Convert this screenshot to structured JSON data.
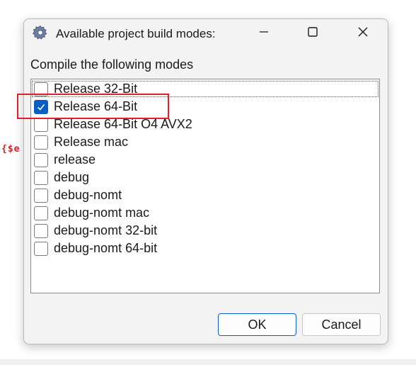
{
  "background": {
    "snippet_text": "{$e"
  },
  "dialog": {
    "title": "Available project build modes:",
    "icons": {
      "app": "gear-icon",
      "minimize": "minimize-icon",
      "maximize": "maximize-icon",
      "close": "close-icon"
    },
    "heading": "Compile the following modes",
    "modes": [
      {
        "label": "Release 32-Bit",
        "checked": false
      },
      {
        "label": "Release 64-Bit",
        "checked": true
      },
      {
        "label": "Release 64-Bit O4 AVX2",
        "checked": false
      },
      {
        "label": "Release mac",
        "checked": false
      },
      {
        "label": "release",
        "checked": false
      },
      {
        "label": "debug",
        "checked": false
      },
      {
        "label": "debug-nomt",
        "checked": false
      },
      {
        "label": "debug-nomt mac",
        "checked": false
      },
      {
        "label": "debug-nomt 32-bit",
        "checked": false
      },
      {
        "label": "debug-nomt 64-bit",
        "checked": false
      }
    ],
    "ok_label": "OK",
    "cancel_label": "Cancel"
  },
  "colors": {
    "accent": "#0a5fc2",
    "annotation": "#e0202a"
  }
}
